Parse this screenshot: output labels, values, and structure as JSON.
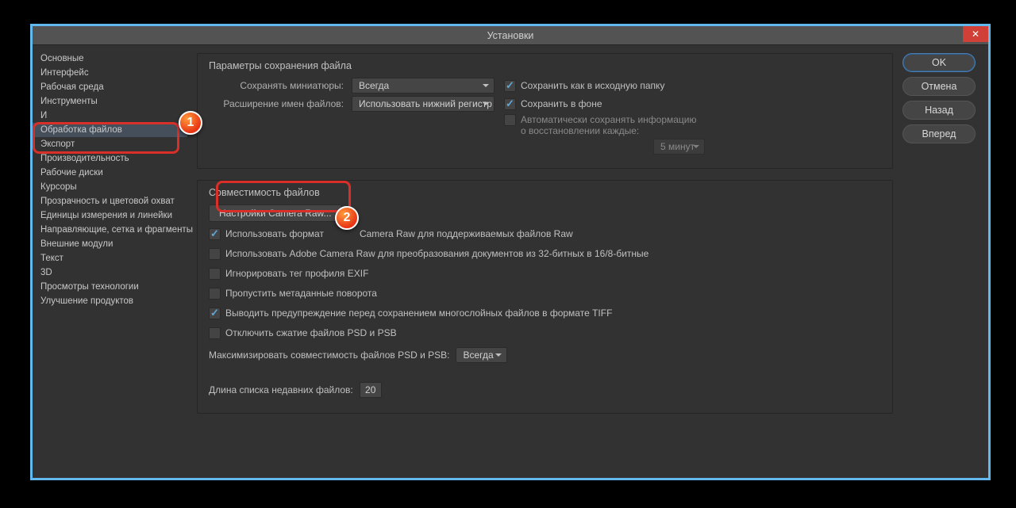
{
  "titlebar": {
    "title": "Установки"
  },
  "sidebar": {
    "items": [
      "Основные",
      "Интерфейс",
      "Рабочая среда",
      "Инструменты",
      "И",
      "Обработка файлов",
      "Экспорт",
      "Производительность",
      "Рабочие диски",
      "Курсоры",
      "Прозрачность и цветовой охват",
      "Единицы измерения и линейки",
      "Направляющие, сетка и фрагменты",
      "Внешние модули",
      "Текст",
      "3D",
      "Просмотры технологии",
      "Улучшение продуктов"
    ],
    "selected_index": 5
  },
  "buttons": {
    "ok": "OK",
    "cancel": "Отмена",
    "back": "Назад",
    "forward": "Вперед"
  },
  "save_panel": {
    "title": "Параметры сохранения файла",
    "thumbs_label": "Сохранять миниатюры:",
    "thumbs_value": "Всегда",
    "ext_label": "Расширение имен файлов:",
    "ext_value": "Использовать нижний регистр",
    "save_orig": "Сохранить как в исходную папку",
    "save_orig_checked": true,
    "save_bg": "Сохранить в фоне",
    "save_bg_checked": true,
    "autosave": "Автоматически сохранять информацию о восстановлении каждые:",
    "autosave_checked": false,
    "autosave_value": "5 минут"
  },
  "compat_panel": {
    "title": "Совместимость файлов",
    "camera_raw_btn": "Настройки Camera Raw...",
    "use_acr": "Использовать формат",
    "use_acr_suffix": "Camera Raw для поддерживаемых файлов Raw",
    "use_acr_checked": true,
    "acr_convert": "Использовать Adobe Camera Raw для преобразования документов из 32-битных в 16/8-битные",
    "acr_convert_checked": false,
    "ignore_exif": "Игнорировать тег профиля EXIF",
    "ignore_exif_checked": false,
    "skip_rotate": "Пропустить метаданные поворота",
    "skip_rotate_checked": false,
    "warn_tiff": "Выводить предупреждение перед сохранением многослойных файлов в формате TIFF",
    "warn_tiff_checked": true,
    "disable_psd_comp": "Отключить сжатие файлов PSD и PSB",
    "disable_psd_comp_checked": false,
    "max_compat_label": "Максимизировать совместимость файлов PSD и PSB:",
    "max_compat_value": "Всегда",
    "recent_label": "Длина списка недавних файлов:",
    "recent_value": "20"
  },
  "badges": {
    "one": "1",
    "two": "2"
  }
}
